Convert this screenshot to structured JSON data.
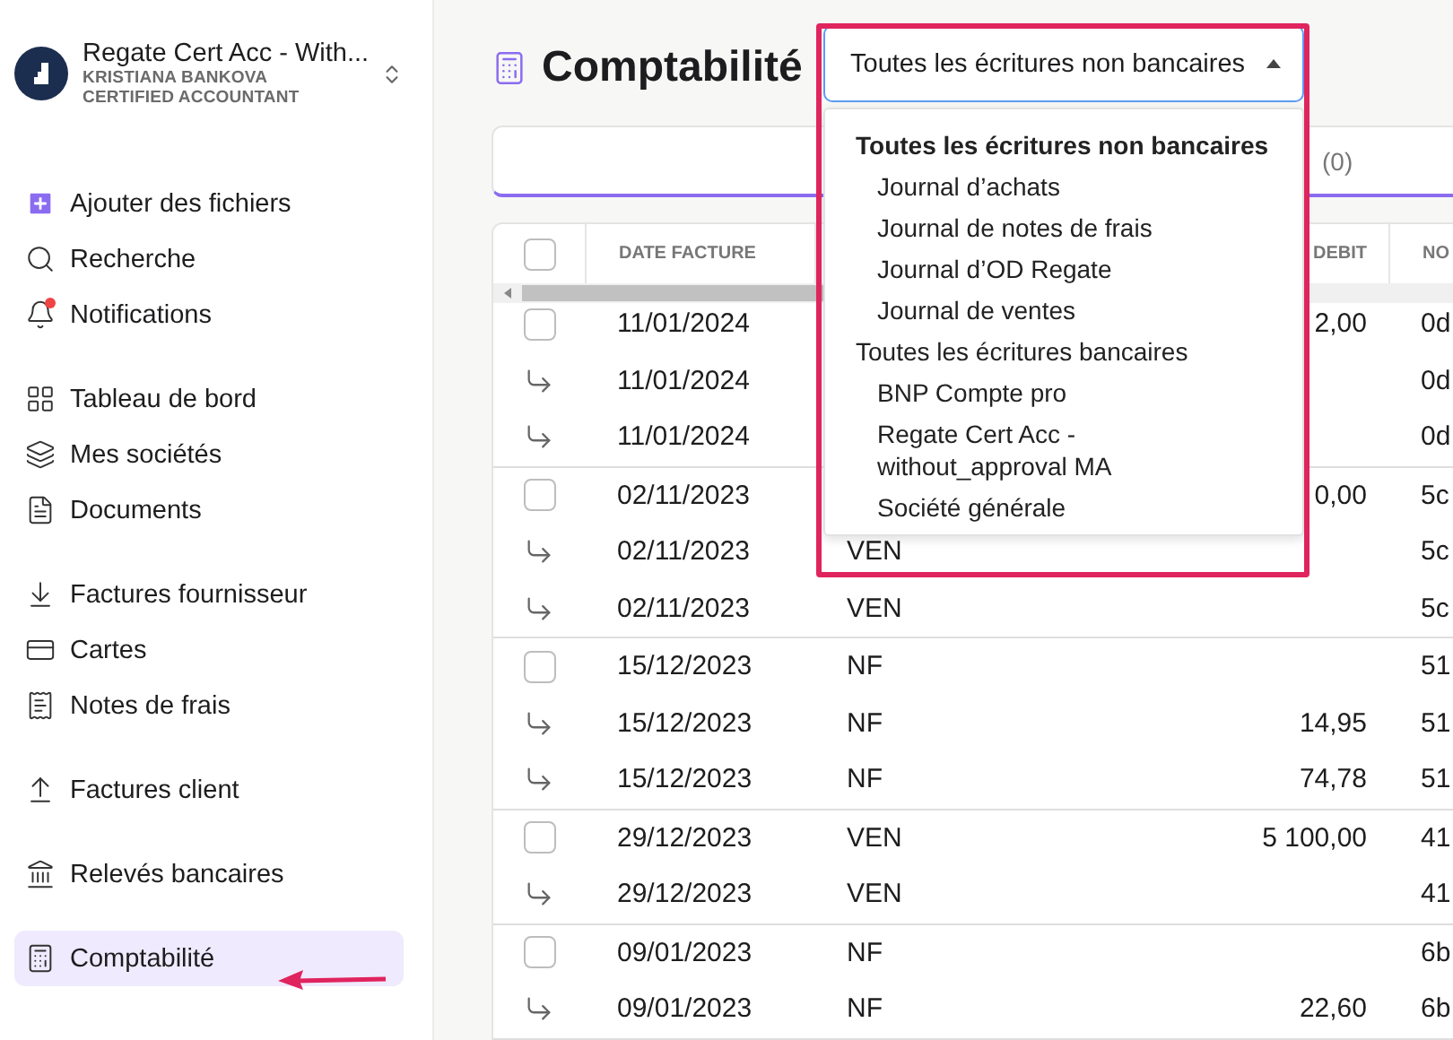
{
  "account": {
    "name": "Regate Cert Acc - With...",
    "user": "KRISTIANA BANKOVA",
    "role": "CERTIFIED ACCOUNTANT"
  },
  "sidebar": {
    "sections": [
      {
        "items": [
          {
            "label": "Ajouter des fichiers",
            "selected": false
          },
          {
            "label": "Recherche",
            "selected": false
          },
          {
            "label": "Notifications",
            "selected": false
          }
        ]
      },
      {
        "items": [
          {
            "label": "Tableau de bord",
            "selected": false
          },
          {
            "label": "Mes sociétés",
            "selected": false
          },
          {
            "label": "Documents",
            "selected": false
          }
        ]
      },
      {
        "items": [
          {
            "label": "Factures fournisseur",
            "selected": false
          },
          {
            "label": "Cartes",
            "selected": false
          },
          {
            "label": "Notes de frais",
            "selected": false
          }
        ]
      },
      {
        "items": [
          {
            "label": "Factures client",
            "selected": false
          }
        ]
      },
      {
        "items": [
          {
            "label": "Relevés bancaires",
            "selected": false
          }
        ]
      },
      {
        "items": [
          {
            "label": "Comptabilité",
            "selected": true
          }
        ]
      }
    ]
  },
  "page": {
    "title": "Comptabilité"
  },
  "tabs": [
    {
      "label": "(0)"
    }
  ],
  "journal_select": {
    "value": "Toutes les écritures non bancaires",
    "expanded": true,
    "options": [
      {
        "label": "Toutes les écritures non bancaires",
        "selected": true,
        "children": [
          {
            "label": "Journal d’achats",
            "selected": false
          },
          {
            "label": "Journal de notes de frais",
            "selected": false
          },
          {
            "label": "Journal d’OD Regate",
            "selected": false
          },
          {
            "label": "Journal de ventes",
            "selected": false
          }
        ]
      },
      {
        "label": "Toutes les écritures bancaires",
        "selected": false,
        "children": [
          {
            "label": "BNP Compte pro",
            "selected": false
          },
          {
            "label": "Regate Cert Acc - without_approval MA",
            "selected": false
          },
          {
            "label": "Société générale",
            "selected": false
          }
        ]
      }
    ]
  },
  "table": {
    "select_all_checked": false,
    "columns": [
      "DATE FACTURE",
      "",
      "DEBIT",
      "NO"
    ],
    "groups": [
      {
        "rows": [
          {
            "kind": "entry",
            "checked": false,
            "date": "11/01/2024",
            "journal": "",
            "debit": "2,00",
            "column_4": "0d"
          },
          {
            "kind": "line",
            "date": "11/01/2024",
            "journal": "",
            "debit": "",
            "column_4": "0d"
          },
          {
            "kind": "line",
            "date": "11/01/2024",
            "journal": "",
            "debit": "",
            "column_4": "0d"
          }
        ]
      },
      {
        "rows": [
          {
            "kind": "entry",
            "checked": false,
            "date": "02/11/2023",
            "journal": "",
            "debit": "0,00",
            "column_4": "5c"
          },
          {
            "kind": "line",
            "date": "02/11/2023",
            "journal": "VEN",
            "debit": "",
            "column_4": "5c"
          },
          {
            "kind": "line",
            "date": "02/11/2023",
            "journal": "VEN",
            "debit": "",
            "column_4": "5c"
          }
        ]
      },
      {
        "rows": [
          {
            "kind": "entry",
            "checked": false,
            "date": "15/12/2023",
            "journal": "NF",
            "debit": "",
            "column_4": "51"
          },
          {
            "kind": "line",
            "date": "15/12/2023",
            "journal": "NF",
            "debit": "14,95",
            "column_4": "51"
          },
          {
            "kind": "line",
            "date": "15/12/2023",
            "journal": "NF",
            "debit": "74,78",
            "column_4": "51"
          }
        ]
      },
      {
        "rows": [
          {
            "kind": "entry",
            "checked": false,
            "date": "29/12/2023",
            "journal": "VEN",
            "debit": "5 100,00",
            "column_4": "41"
          },
          {
            "kind": "line",
            "date": "29/12/2023",
            "journal": "VEN",
            "debit": "",
            "column_4": "41"
          }
        ]
      },
      {
        "rows": [
          {
            "kind": "entry",
            "checked": false,
            "date": "09/01/2023",
            "journal": "NF",
            "debit": "",
            "column_4": "6b"
          },
          {
            "kind": "line",
            "date": "09/01/2023",
            "journal": "NF",
            "debit": "22,60",
            "column_4": "6b"
          }
        ]
      }
    ]
  }
}
